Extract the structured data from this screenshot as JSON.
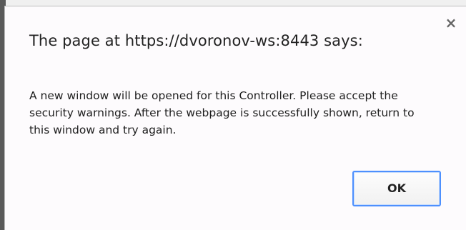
{
  "dialog": {
    "title": "The page at https://dvoronov-ws:8443 says:",
    "message": "A new window will be opened for this Controller. Please accept the security warnings. After the webpage is successfully shown, return to this window and try again.",
    "close_glyph": "×",
    "ok_label": "OK",
    "close_icon": "close-icon"
  },
  "colors": {
    "button_focus_border": "#4d90fe",
    "dialog_background": "#fdfbfd"
  }
}
